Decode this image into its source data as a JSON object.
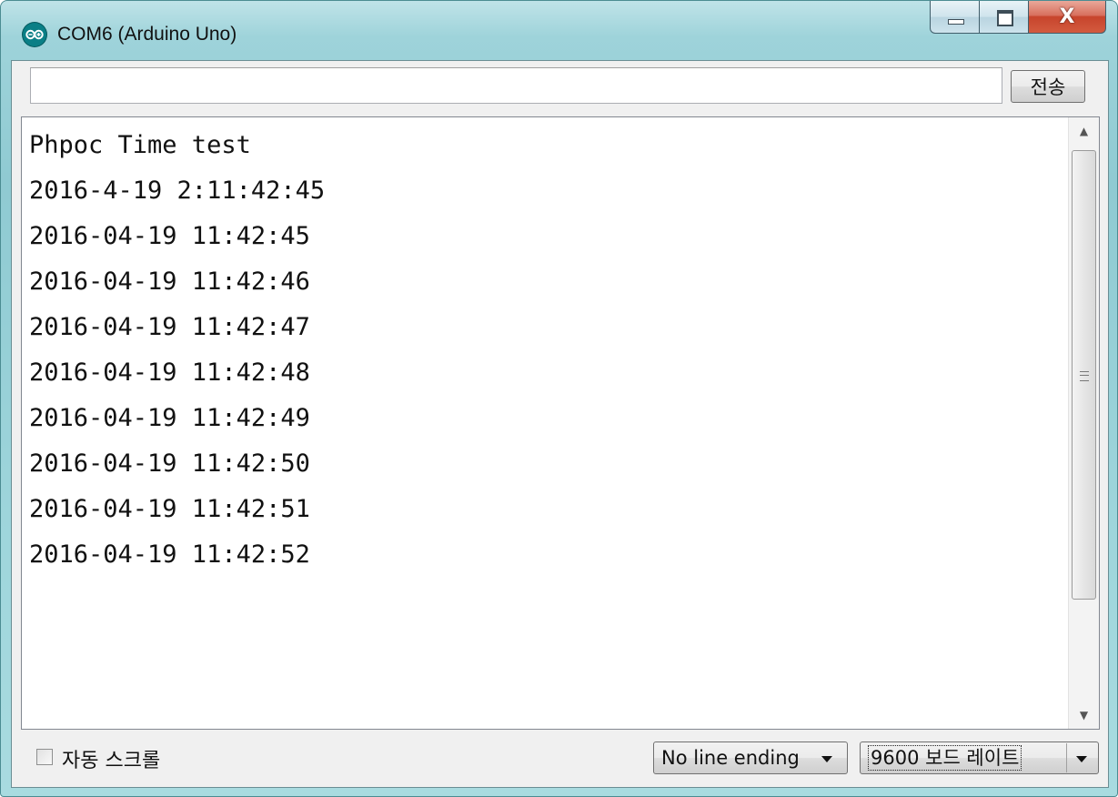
{
  "window": {
    "title": "COM6 (Arduino Uno)",
    "icon": "arduino-infinity-icon",
    "caption_close": "X"
  },
  "toolbar": {
    "input_value": "",
    "send_label": "전송"
  },
  "output": {
    "lines": [
      "Phpoc Time test",
      "2016-4-19 2:11:42:45",
      "2016-04-19 11:42:45",
      "2016-04-19 11:42:46",
      "2016-04-19 11:42:47",
      "2016-04-19 11:42:48",
      "2016-04-19 11:42:49",
      "2016-04-19 11:42:50",
      "2016-04-19 11:42:51",
      "2016-04-19 11:42:52"
    ]
  },
  "footer": {
    "autoscroll_label": "자동 스크롤",
    "autoscroll_checked": false,
    "line_ending_value": "No line ending",
    "baud_value": "9600 보드 레이트"
  }
}
